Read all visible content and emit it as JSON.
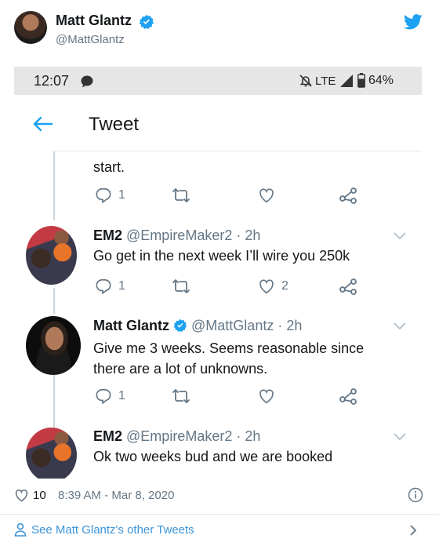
{
  "embed": {
    "author_name": "Matt Glantz",
    "author_handle": "@MattGlantz",
    "brand_color": "#1da1f2",
    "verified_color": "#1da1f2",
    "like_count": "10",
    "timestamp": "8:39 AM - Mar 8, 2020",
    "other_tweets_link": "See Matt Glantz's other Tweets"
  },
  "phone": {
    "status_bar": {
      "time": "12:07",
      "network": "LTE",
      "battery": "64%"
    },
    "header_title": "Tweet",
    "tweets": [
      {
        "text": "start.",
        "reply_count": "1",
        "like_count": ""
      },
      {
        "name": "EM2",
        "handle": "@EmpireMaker2",
        "time": "· 2h",
        "text": "Go get in the next week I’ll wire you 250k",
        "reply_count": "1",
        "like_count": "2"
      },
      {
        "name": "Matt Glantz",
        "handle": "@MattGlantz",
        "time": "· 2h",
        "text": "Give me 3 weeks. Seems reasonable since there are a lot of unknowns.",
        "reply_count": "1",
        "like_count": ""
      },
      {
        "name": "EM2",
        "handle": "@EmpireMaker2",
        "time": "· 2h",
        "text": "Ok two weeks bud and we are booked"
      }
    ]
  }
}
